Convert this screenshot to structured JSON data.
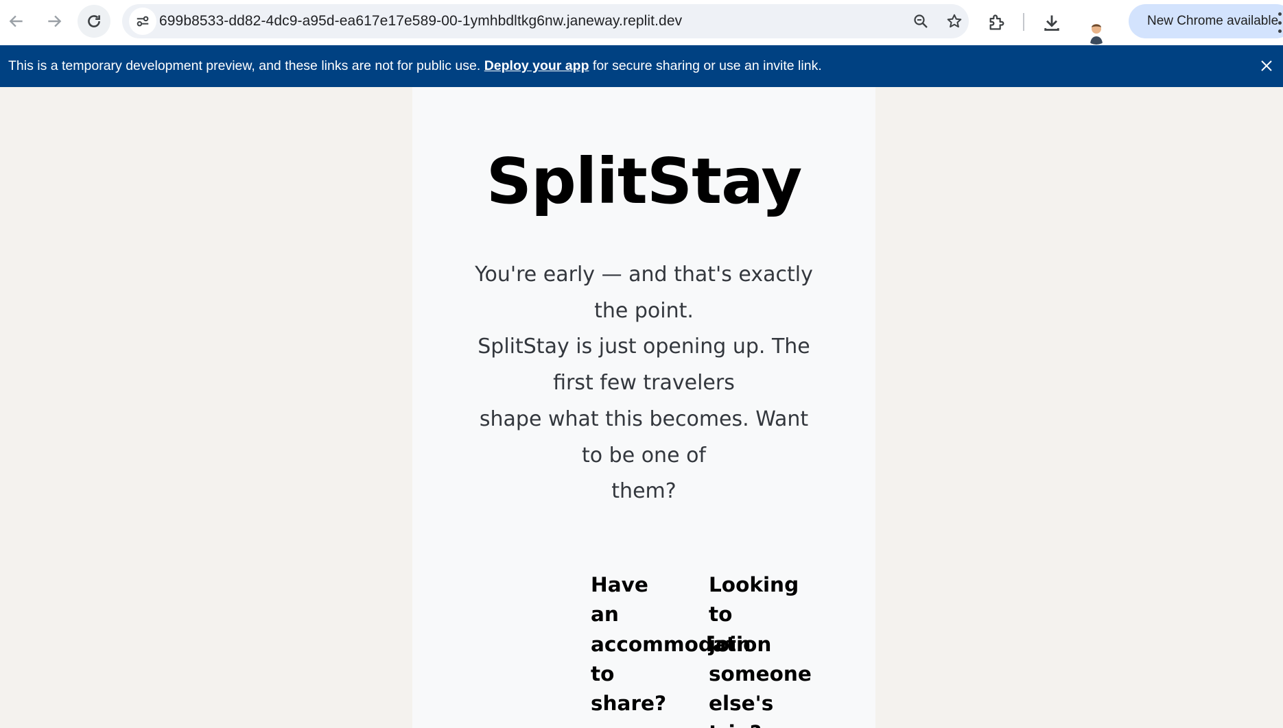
{
  "browser": {
    "url": "699b8533-dd82-4dc9-a95d-ea617e17e589-00-1ymhbdltkg6nw.janeway.replit.dev",
    "update_label": "New Chrome available",
    "icons": [
      "back-arrow-icon",
      "forward-arrow-icon",
      "reload-icon",
      "site-info-icon",
      "zoom-icon",
      "bookmark-star-icon",
      "extensions-icon",
      "download-icon",
      "profile-avatar",
      "kebab-menu-icon"
    ]
  },
  "banner": {
    "text_before": "This is a temporary development preview, and these links are not for public use. ",
    "link_label": "Deploy your app",
    "text_after": " for secure sharing or use an invite link.",
    "background": "#004182"
  },
  "page": {
    "title": "SplitStay",
    "tagline_lines": [
      "You're early — and that's exactly the point.",
      "SplitStay is just opening up. The first few travelers",
      "shape what this becomes. Want to be one of",
      "them?"
    ],
    "host_choice_words": [
      "Have",
      "an",
      "accommodation",
      "to",
      "share?"
    ],
    "join_choice_words": [
      "Looking",
      "to",
      "join",
      "someone",
      "else's",
      "trip?"
    ]
  }
}
